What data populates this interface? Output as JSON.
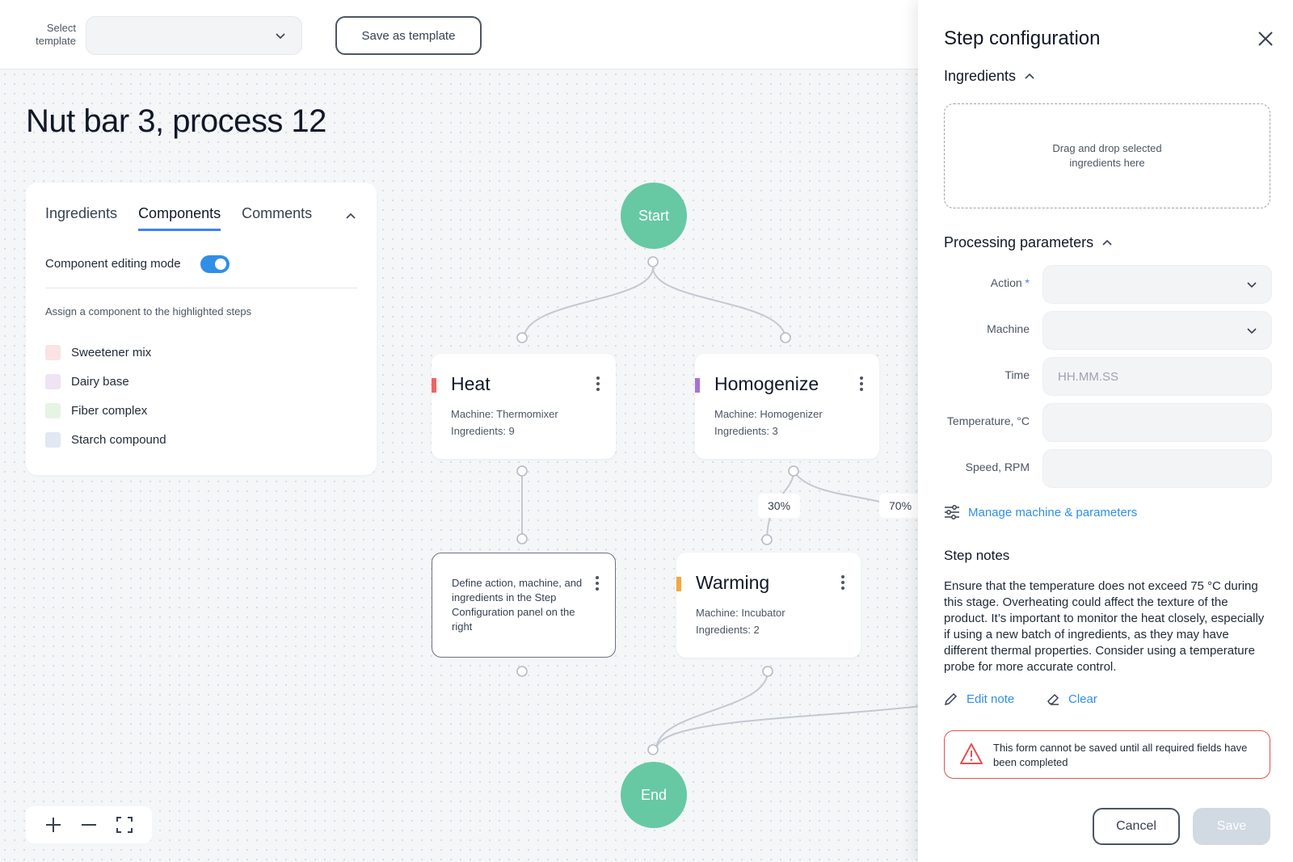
{
  "toolbar": {
    "select_template_label": "Select template",
    "select_template_value": "",
    "save_template_label": "Save as template"
  },
  "page": {
    "title": "Nut bar 3, process 12"
  },
  "left_panel": {
    "tabs": [
      {
        "label": "Ingredients",
        "active": false
      },
      {
        "label": "Components",
        "active": true
      },
      {
        "label": "Comments",
        "active": false
      }
    ],
    "editing_mode_label": "Component editing mode",
    "editing_mode_on": true,
    "assign_text": "Assign a component to the highlighted steps",
    "components": [
      {
        "label": "Sweetener mix",
        "color": "#fbe3e3"
      },
      {
        "label": "Dairy base",
        "color": "#efe4f3"
      },
      {
        "label": "Fiber complex",
        "color": "#e5f4e3"
      },
      {
        "label": "Starch compound",
        "color": "#e1e8f3"
      }
    ]
  },
  "flow": {
    "start_label": "Start",
    "end_label": "End",
    "steps": [
      {
        "name": "Heat",
        "machine": "Machine: Thermomixer",
        "ingredients": "Ingredients: 9",
        "color": "#f06464"
      },
      {
        "name": "Homogenize",
        "machine": "Machine: Homogenizer",
        "ingredients": "Ingredients: 3",
        "color": "#a872d9"
      },
      {
        "name": "Warming",
        "machine": "Machine: Incubator",
        "ingredients": "Ingredients: 2",
        "color": "#f5a83a"
      }
    ],
    "empty_step_hint": "Define action, machine, and ingredients in the Step Configuration panel on the right",
    "split_left": "30%",
    "split_right": "70%"
  },
  "config": {
    "title": "Step configuration",
    "ingredients_section": "Ingredients",
    "dropzone_text": "Drag and drop selected ingredients here",
    "processing_section": "Processing parameters",
    "params": [
      {
        "label": "Action",
        "required": true,
        "type": "select",
        "placeholder": ""
      },
      {
        "label": "Machine",
        "required": false,
        "type": "select",
        "placeholder": ""
      },
      {
        "label": "Time",
        "required": false,
        "type": "text",
        "placeholder": "HH.MM.SS"
      },
      {
        "label": "Temperature, °C",
        "required": false,
        "type": "text",
        "placeholder": ""
      },
      {
        "label": "Speed, RPM",
        "required": false,
        "type": "text",
        "placeholder": ""
      }
    ],
    "manage_link": "Manage machine & parameters",
    "notes_section": "Step notes",
    "notes_text": "Ensure that the temperature does not exceed 75 °C during this stage. Overheating could affect the texture of the product. It’s important to monitor the heat closely, especially if using a new batch of ingredients, as they may have different thermal properties. Consider using a temperature probe for more accurate control.",
    "edit_note_label": "Edit note",
    "clear_label": "Clear",
    "alert_text": "This form cannot be saved until all required fields have been completed",
    "cancel_label": "Cancel",
    "save_label": "Save"
  },
  "colors": {
    "accent": "#2f8fe8",
    "node_green": "#66c9a3",
    "error": "#e05252"
  }
}
